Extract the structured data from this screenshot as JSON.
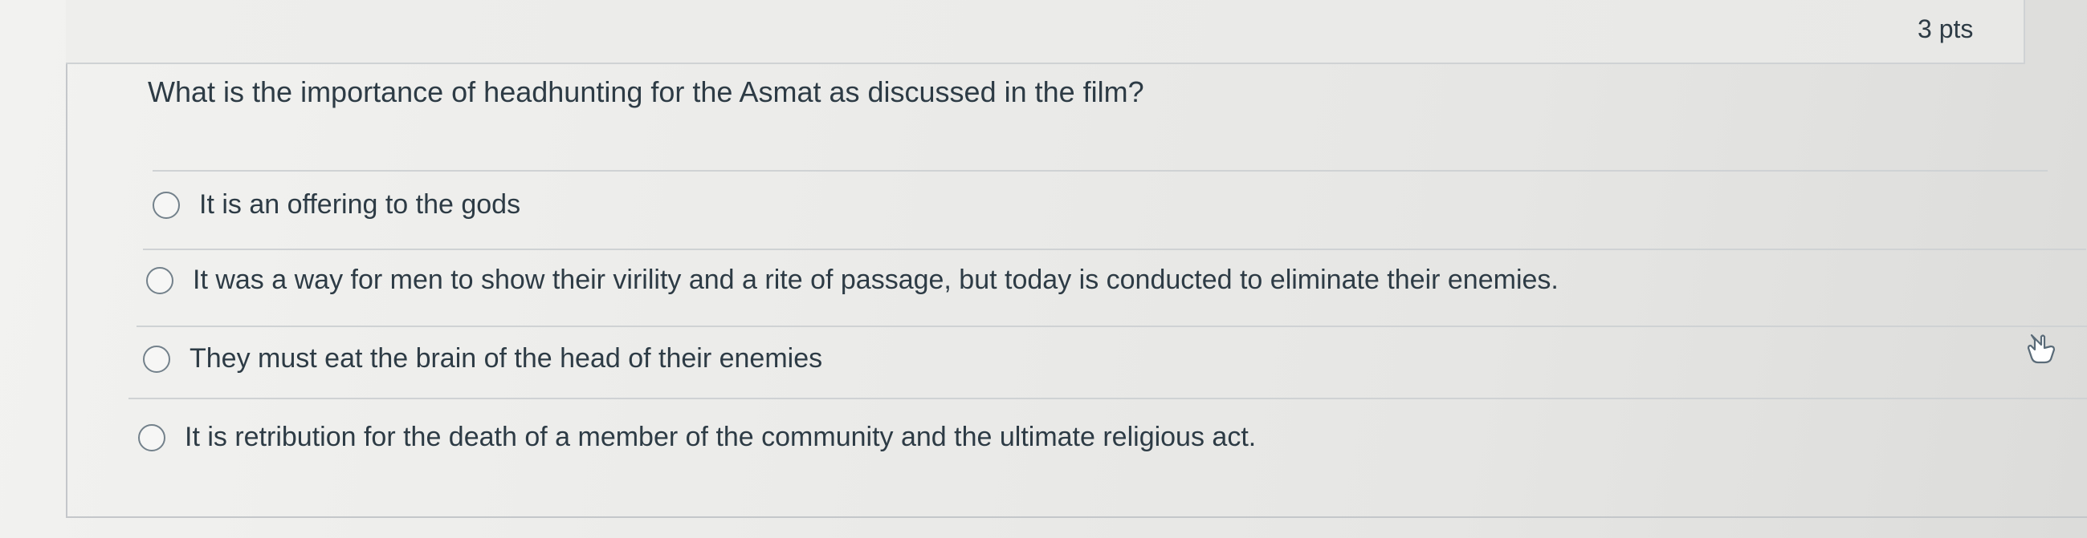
{
  "question": {
    "points_label": "3 pts",
    "text": "What is the importance of headhunting for the Asmat as discussed in the film?"
  },
  "answers": [
    {
      "label": "It is an offering to the gods"
    },
    {
      "label": "It was a way for men to show their virility and a rite of passage, but today is conducted to eliminate their enemies."
    },
    {
      "label": "They must eat the brain of the head of their enemies"
    },
    {
      "label": "It is retribution for the death of a member of the community and the ultimate religious act."
    }
  ],
  "cursor": {
    "icon": "hand-pointer-icon"
  }
}
